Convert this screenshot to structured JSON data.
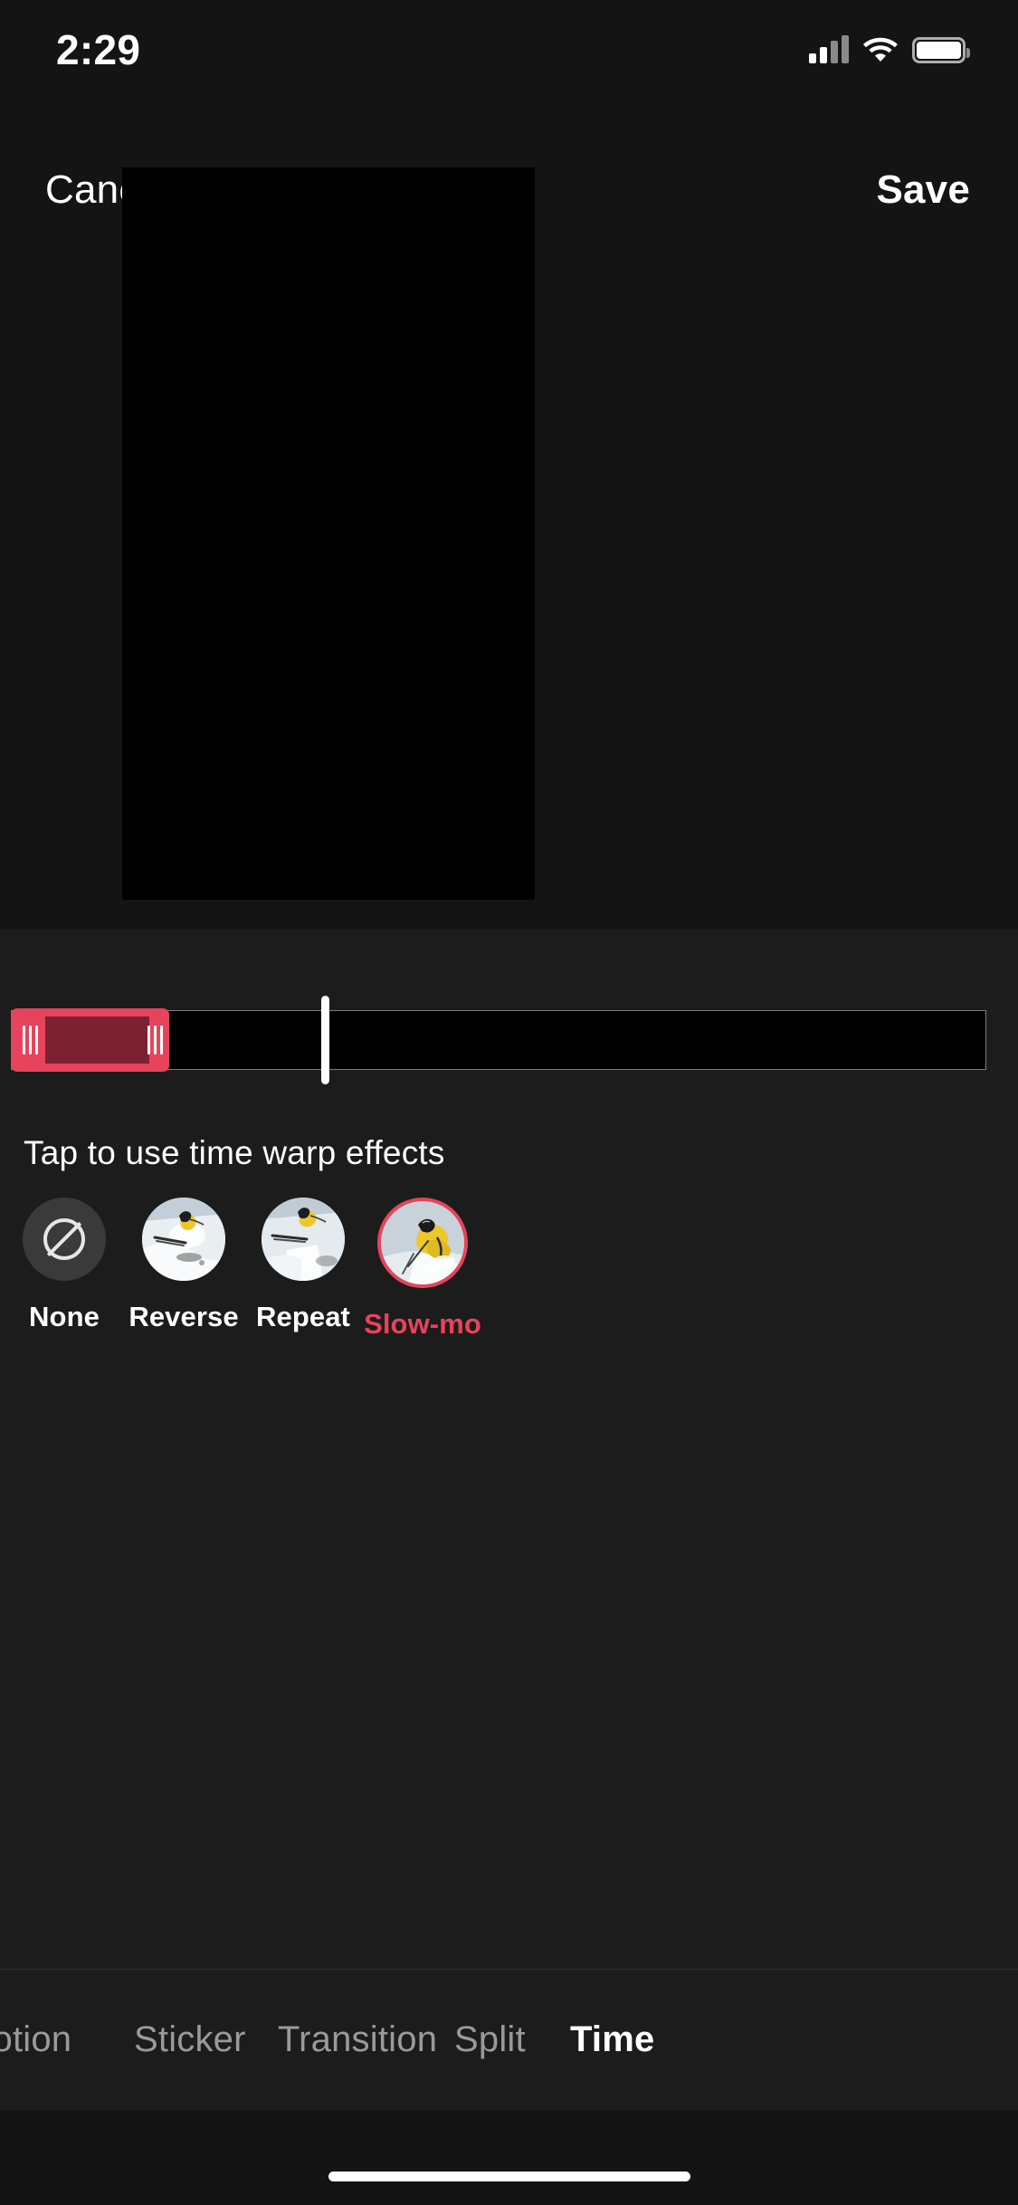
{
  "status_bar": {
    "time": "2:29",
    "signal_icon": "cellular-signal-icon",
    "wifi_icon": "wifi-icon",
    "battery_icon": "battery-full-icon"
  },
  "header": {
    "cancel_label": "Cancel",
    "save_label": "Save"
  },
  "preview": {
    "name": "video-preview",
    "background_color": "#000000"
  },
  "timeline": {
    "hint": "Tap to use time warp effects",
    "track_color": "#000000",
    "selection_color": "#E8435C",
    "selection_fill_color": "#7C2132",
    "playhead_color": "#FFFFFF",
    "left_handle_icon": "trim-handle-left-icon",
    "right_handle_icon": "trim-handle-right-icon",
    "playhead_icon": "playhead-icon"
  },
  "effects": {
    "items": [
      {
        "label": "None",
        "icon": "no-effect-icon",
        "selected": false
      },
      {
        "label": "Reverse",
        "icon": "reverse-thumbnail",
        "selected": false
      },
      {
        "label": "Repeat",
        "icon": "repeat-thumbnail",
        "selected": false
      },
      {
        "label": "Slow-mo",
        "icon": "slow-mo-thumbnail",
        "selected": true
      }
    ],
    "selected_label": "Slow-mo",
    "accent_color": "#E8435C"
  },
  "tabbar": {
    "items": [
      {
        "label": "Motion",
        "active": false
      },
      {
        "label": "Sticker",
        "active": false
      },
      {
        "label": "Transition",
        "active": false
      },
      {
        "label": "Split",
        "active": false
      },
      {
        "label": "Time",
        "active": true
      }
    ],
    "active_label": "Time",
    "inactive_color": "#9A9A9A",
    "active_color": "#FFFFFF"
  },
  "home_indicator": {
    "name": "home-indicator"
  }
}
